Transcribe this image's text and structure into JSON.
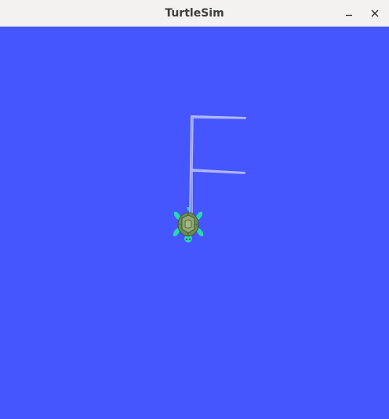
{
  "window": {
    "title": "TurtleSim",
    "controls": {
      "minimize_icon": "minimize-icon",
      "close_icon": "close-icon"
    }
  },
  "canvas": {
    "background_color": "#4556ff",
    "pen_color": "#b3b8ff",
    "turtle_icon": "turtle-icon"
  }
}
